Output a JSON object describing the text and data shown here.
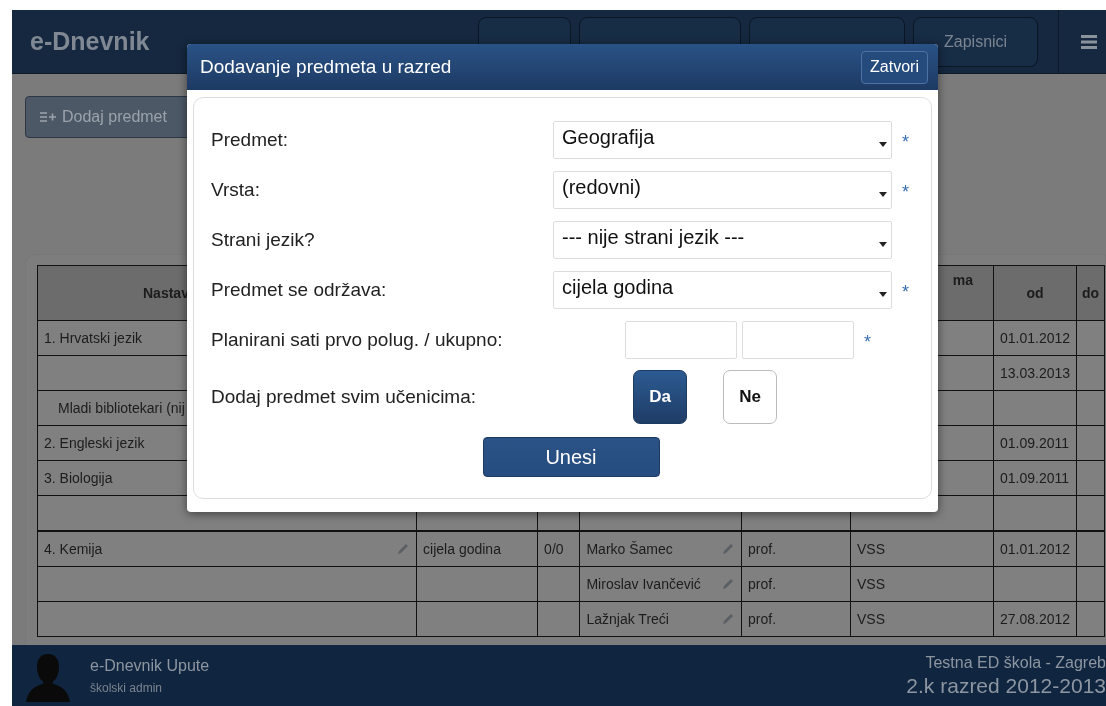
{
  "app": {
    "title": "e-Dnevnik",
    "nav": [
      {
        "kind": "covered"
      },
      {
        "kind": "covered"
      },
      {
        "kind": "covered"
      },
      {
        "kind": "labelled",
        "label": "Zapisnici"
      }
    ]
  },
  "toolbar": {
    "add_button": "Dodaj predmet"
  },
  "table": {
    "header": {
      "subject": "Nastav",
      "degree": "ma",
      "from": "od",
      "to": "do"
    },
    "rows": [
      {
        "kind": "subject",
        "subject": "1. Hrvatski jezik",
        "from": "01.01.2012"
      },
      {
        "kind": "continuation",
        "from": "13.03.2013"
      },
      {
        "kind": "sub",
        "subject": "Mladi bibliotekari (nij"
      },
      {
        "kind": "subject",
        "subject": "2. Engleski jezik",
        "from": "01.09.2011"
      },
      {
        "kind": "subject",
        "subject": "3. Biologija",
        "from": "01.09.2011"
      },
      {
        "kind": "continuation"
      },
      {
        "kind": "subject",
        "subject": "4. Kemija",
        "duration": "cijela godina",
        "hours": "0/0",
        "teacher": "Marko Šamec",
        "title": "prof.",
        "degree": "VSS",
        "from": "01.01.2012"
      },
      {
        "kind": "continuation",
        "teacher": "Miroslav Ivančević",
        "title": "prof.",
        "degree": "VSS"
      },
      {
        "kind": "continuation",
        "teacher": "Lažnjak Treći",
        "title": "prof.",
        "degree": "VSS",
        "from": "27.08.2012"
      }
    ]
  },
  "dialog": {
    "title": "Dodavanje predmeta u razred",
    "close": "Zatvori",
    "fields": [
      {
        "kind": "select",
        "label": "Predmet:",
        "value": "Geografija",
        "marker": "*"
      },
      {
        "kind": "select",
        "label": "Vrsta:",
        "value": "(redovni)",
        "marker": "*"
      },
      {
        "kind": "select",
        "label": "Strani jezik?",
        "value": "--- nije strani jezik ---"
      },
      {
        "kind": "select",
        "label": "Predmet se održava:",
        "value": "cijela godina",
        "marker": "*"
      },
      {
        "kind": "pair",
        "label": "Planirani sati prvo polug. / ukupno:",
        "marker": "*"
      },
      {
        "kind": "toggle",
        "label": "Dodaj predmet svim učenicima:",
        "options": [
          {
            "label": "Da",
            "selected": true
          },
          {
            "label": "Ne",
            "selected": false
          }
        ]
      }
    ],
    "submit": "Unesi"
  },
  "footer": {
    "user": "e-Dnevnik Upute",
    "role": "školski admin",
    "school": "Testna ED škola - Zagreb",
    "class": "2.k razred 2012-2013"
  }
}
